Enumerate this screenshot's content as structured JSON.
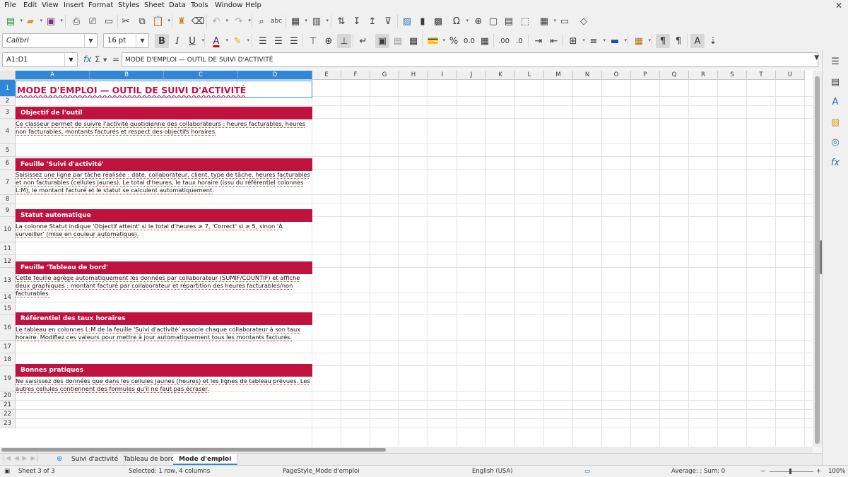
{
  "menu": [
    "File",
    "Edit",
    "View",
    "Insert",
    "Format",
    "Styles",
    "Sheet",
    "Data",
    "Tools",
    "Window",
    "Help"
  ],
  "font": {
    "name": "Calibri",
    "size": "16 pt"
  },
  "formula_bar": {
    "cell_ref": "A1:D1",
    "content": "MODE D'EMPLOI — OUTIL DE SUIVI D'ACTIVITÉ"
  },
  "columns": [
    "A",
    "B",
    "C",
    "D",
    "E",
    "F",
    "G",
    "H",
    "I",
    "J",
    "K",
    "L",
    "M",
    "N",
    "O",
    "P",
    "Q",
    "R",
    "S",
    "T",
    "U"
  ],
  "rows": [
    "1",
    "2",
    "3",
    "4",
    "5",
    "6",
    "7",
    "8",
    "9",
    "10",
    "11",
    "12",
    "13",
    "14",
    "15",
    "16",
    "17",
    "18",
    "19",
    "20",
    "21",
    "22",
    "23"
  ],
  "sheet": {
    "title": "MODE D'EMPLOI — OUTIL DE SUIVI D'ACTIVITÉ",
    "sections": [
      {
        "heading": "Objectif de l'outil",
        "body": "Ce classeur permet de suivre l'activité quotidienne des collaborateurs : heures facturables, heures non facturables, montants facturés et respect des objectifs horaires."
      },
      {
        "heading": "Feuille 'Suivi d'activité'",
        "body": "Saisissez une ligne par tâche réalisée : date, collaborateur, client, type de tâche, heures facturables et non facturables (cellules jaunes). Le total d'heures, le taux horaire (issu du référentiel colonnes L:M), le montant facturé et le statut se calculent automatiquement."
      },
      {
        "heading": "Statut automatique",
        "body": "La colonne Statut indique 'Objectif atteint' si le total d'heures ≥ 7, 'Correct' si ≥ 5, sinon 'À surveiller' (mise en couleur automatique)."
      },
      {
        "heading": "Feuille 'Tableau de bord'",
        "body": "Cette feuille agrège automatiquement les données par collaborateur (SUMIF/COUNTIF) et affiche deux graphiques : montant facturé par collaborateur et répartition des heures facturables/non facturables."
      },
      {
        "heading": "Référentiel des taux horaires",
        "body": "Le tableau en colonnes L:M de la feuille 'Suivi d'activité' associe chaque collaborateur à son taux horaire. Modifiez ces valeurs pour mettre à jour automatiquement tous les montants facturés."
      },
      {
        "heading": "Bonnes pratiques",
        "body": "Ne saisissez des données que dans les cellules jaunes (heures) et les lignes de tableau prévues. Les autres cellules contiennent des formules qu'il ne faut pas écraser."
      }
    ]
  },
  "tabs": [
    "Suivi d'activité",
    "Tableau de bord",
    "Mode d'emploi"
  ],
  "active_tab": "Mode d'emploi",
  "status": {
    "sheet": "Sheet 3 of 3",
    "selection": "Selected: 1 row, 4 columns",
    "page_style": "PageStyle_Mode d'emploi",
    "language": "English (USA)",
    "summary": "Average: ; Sum: 0",
    "zoom": "100%"
  },
  "colors": {
    "accent": "#c0123f",
    "selection": "#2d88d9"
  }
}
